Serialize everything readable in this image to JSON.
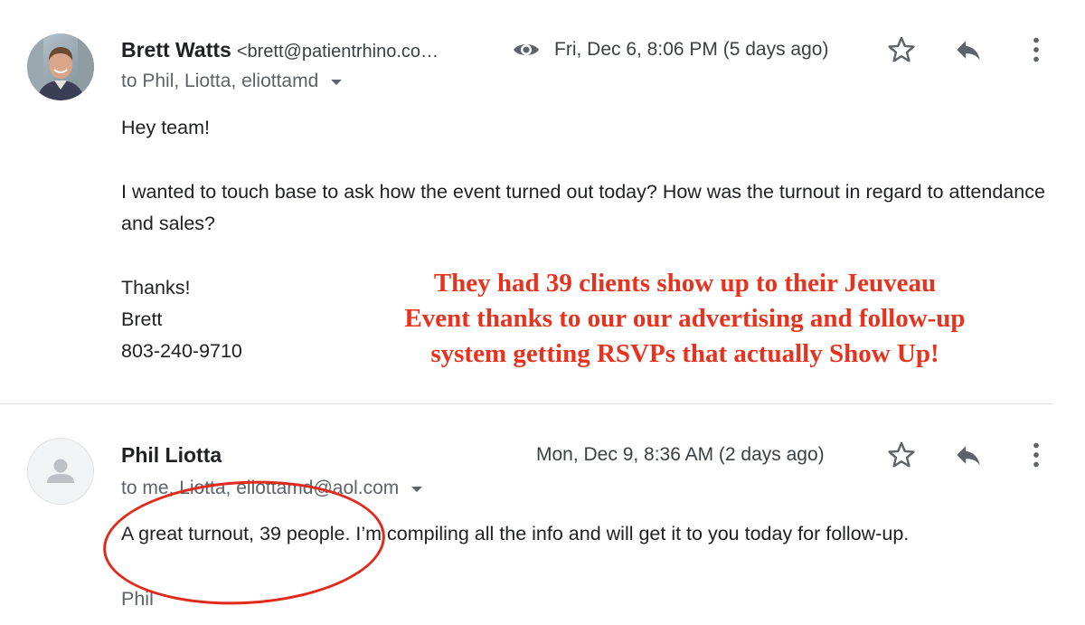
{
  "messages": [
    {
      "sender_name": "Brett Watts",
      "sender_email": "<brett@patientrhino.co…",
      "recipients": "to Phil, Liotta, eliottamd",
      "date": "Fri, Dec 6, 8:06 PM (5 days ago)",
      "body": {
        "greeting": "Hey team!",
        "question": "I wanted to touch base to ask how the event turned out today? How was the turnout in regard to attendance and sales?",
        "signoff": [
          "Thanks!",
          "Brett",
          "803-240-9710"
        ]
      }
    },
    {
      "sender_name": "Phil Liotta",
      "recipients": "to me, Liotta, eliottamd@aol.com",
      "date": "Mon, Dec 9, 8:36 AM (2 days ago)",
      "body": {
        "text": "A great turnout, 39 people. I’m compiling all the info and will get it to you today for follow-up.",
        "signoff": "Phil"
      }
    }
  ],
  "annotation": {
    "lines": [
      "They had 39 clients show up to their Jeuveau",
      "Event thanks to our our advertising and follow-up",
      "system getting RSVPs that actually Show Up!"
    ],
    "color": "#e8321e"
  },
  "icons": {
    "seen": "eye-icon",
    "star": "star-icon",
    "reply": "reply-icon",
    "more": "more-vert-icon",
    "default_avatar": "person-icon"
  }
}
